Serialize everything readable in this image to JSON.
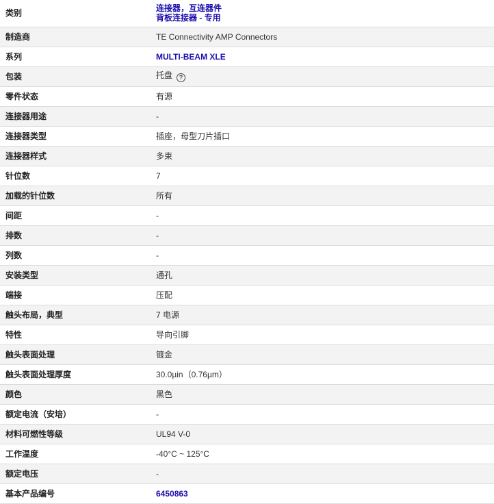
{
  "specs": {
    "category": {
      "label": "类别",
      "links": [
        "连接器，互连器件",
        "背板连接器 - 专用"
      ]
    },
    "manufacturer": {
      "label": "制造商",
      "value": "TE Connectivity AMP Connectors"
    },
    "series": {
      "label": "系列",
      "value": "MULTI-BEAM XLE"
    },
    "packaging": {
      "label": "包装",
      "value": "托盘",
      "help_icon": "question-circle-icon",
      "help_glyph": "?"
    },
    "part_status": {
      "label": "零件状态",
      "value": "有源"
    },
    "connector_usage": {
      "label": "连接器用途",
      "value": "-"
    },
    "connector_type": {
      "label": "连接器类型",
      "value": "插座，母型刀片插口"
    },
    "connector_style": {
      "label": "连接器样式",
      "value": "多束"
    },
    "pin_count": {
      "label": "针位数",
      "value": "7"
    },
    "loaded_pin_count": {
      "label": "加载的针位数",
      "value": "所有"
    },
    "pitch": {
      "label": "间距",
      "value": "-"
    },
    "row_count": {
      "label": "排数",
      "value": "-"
    },
    "column_count": {
      "label": "列数",
      "value": "-"
    },
    "mounting_type": {
      "label": "安装类型",
      "value": "通孔"
    },
    "termination": {
      "label": "端接",
      "value": "压配"
    },
    "contact_layout": {
      "label": "触头布局，典型",
      "value": "7 电源"
    },
    "features": {
      "label": "特性",
      "value": "导向引脚"
    },
    "contact_finish": {
      "label": "触头表面处理",
      "value": "镀金"
    },
    "contact_finish_thickness": {
      "label": "触头表面处理厚度",
      "value": "30.0µin（0.76µm）"
    },
    "color": {
      "label": "颜色",
      "value": "黑色"
    },
    "current_rating": {
      "label": "额定电流（安培）",
      "value": "-"
    },
    "flammability_rating": {
      "label": "材料可燃性等级",
      "value": "UL94 V-0"
    },
    "operating_temperature": {
      "label": "工作温度",
      "value": "-40°C ~ 125°C"
    },
    "voltage_rating": {
      "label": "额定电压",
      "value": "-"
    },
    "base_product_number": {
      "label": "基本产品编号",
      "value": "6450863"
    }
  },
  "colors": {
    "link": "#1a0dab",
    "alt_row": "#f3f3f3",
    "divider": "#dcdcdc"
  }
}
